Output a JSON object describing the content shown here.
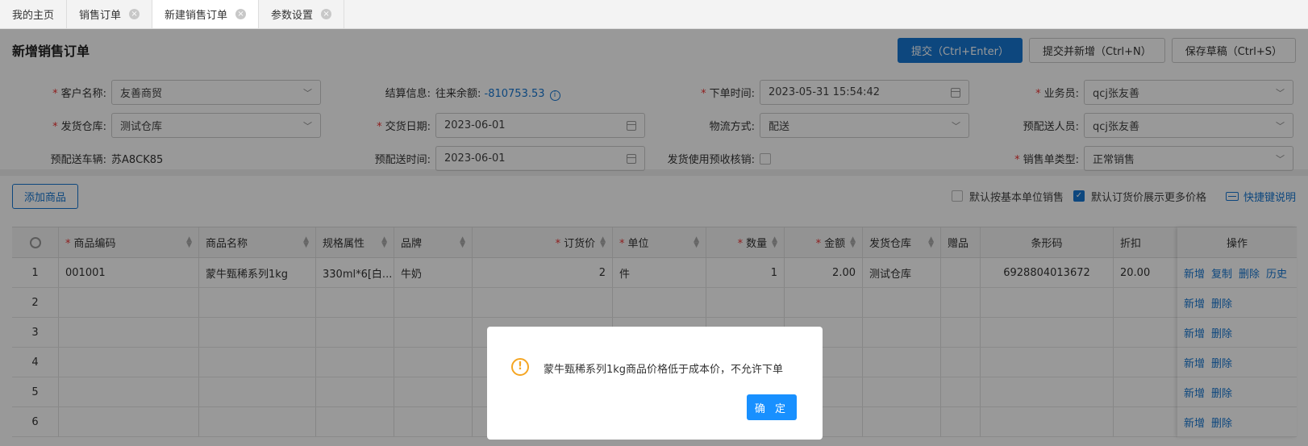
{
  "tabs": [
    {
      "label": "我的主页",
      "closable": false,
      "active": false
    },
    {
      "label": "销售订单",
      "closable": true,
      "active": false
    },
    {
      "label": "新建销售订单",
      "closable": true,
      "active": true
    },
    {
      "label": "参数设置",
      "closable": true,
      "active": false
    }
  ],
  "header": {
    "title": "新增销售订单",
    "submit": "提交（Ctrl+Enter）",
    "submit_new": "提交并新增（Ctrl+N）",
    "save_draft": "保存草稿（Ctrl+S）"
  },
  "form": {
    "customer": {
      "label": "客户名称:",
      "value": "友善商贸"
    },
    "settlement": {
      "label": "结算信息:",
      "prefix": "往来余额:",
      "balance": "-810753.53"
    },
    "order_time": {
      "label": "下单时间:",
      "value": "2023-05-31 15:54:42"
    },
    "salesman": {
      "label": "业务员:",
      "value": "qcj张友善"
    },
    "warehouse": {
      "label": "发货仓库:",
      "value": "测试仓库"
    },
    "delivery_date": {
      "label": "交货日期:",
      "value": "2023-06-01"
    },
    "logistics": {
      "label": "物流方式:",
      "value": "配送"
    },
    "delivery_person": {
      "label": "预配送人员:",
      "value": "qcj张友善"
    },
    "vehicle": {
      "label": "预配送车辆:",
      "value": "苏A8CK85"
    },
    "delivery_time": {
      "label": "预配送时间:",
      "value": "2023-06-01"
    },
    "prepay": {
      "label": "发货使用预收核销:"
    },
    "order_type": {
      "label": "销售单类型:",
      "value": "正常销售"
    }
  },
  "toolbar": {
    "add_product": "添加商品",
    "base_unit": "默认按基本单位销售",
    "more_price": "默认订货价展示更多价格",
    "shortcut": "快捷键说明"
  },
  "table": {
    "headers": {
      "code": "商品编码",
      "name": "商品名称",
      "spec": "规格属性",
      "brand": "品牌",
      "price": "订货价",
      "unit": "单位",
      "qty": "数量",
      "amount": "金额",
      "warehouse": "发货仓库",
      "gift": "赠品",
      "barcode": "条形码",
      "discount": "折扣",
      "ops": "操作"
    },
    "rows": [
      {
        "no": "1",
        "code": "001001",
        "name": "蒙牛甄稀系列1kg",
        "spec": "330ml*6[白...",
        "brand": "牛奶",
        "price": "2",
        "unit": "件",
        "qty": "1",
        "amount": "2.00",
        "warehouse": "测试仓库",
        "gift": "",
        "barcode": "6928804013672",
        "discount": "20.00"
      },
      {
        "no": "2"
      },
      {
        "no": "3"
      },
      {
        "no": "4"
      },
      {
        "no": "5"
      },
      {
        "no": "6"
      }
    ],
    "ops": {
      "add": "新增",
      "copy": "复制",
      "delete": "删除",
      "history": "历史"
    }
  },
  "modal": {
    "message": "蒙牛甄稀系列1kg商品价格低于成本价，不允许下单",
    "ok": "确 定"
  }
}
